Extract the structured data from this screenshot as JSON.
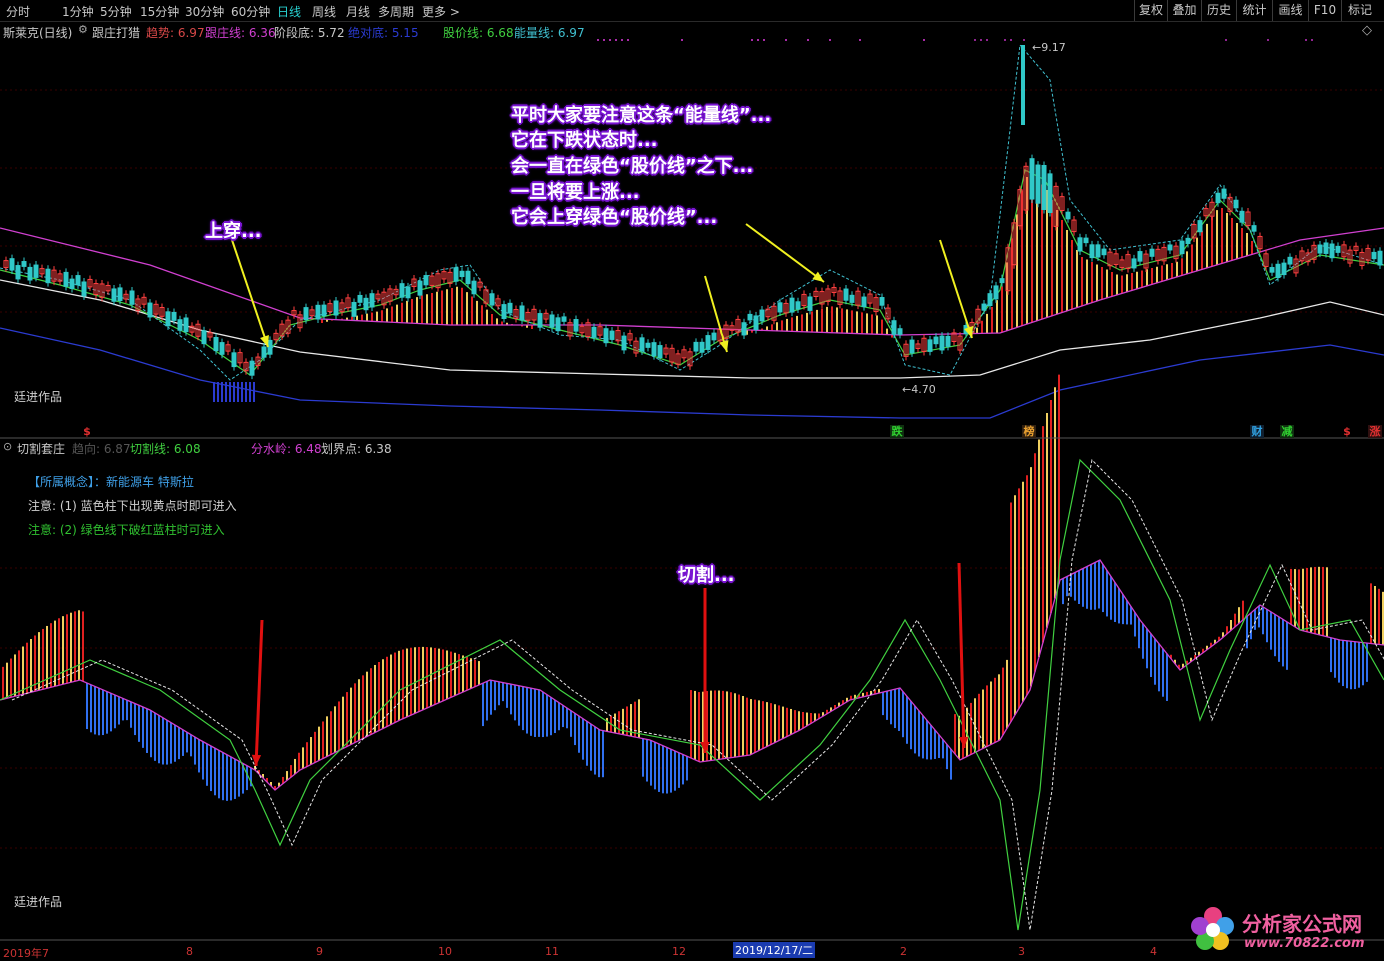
{
  "toolbar": {
    "periods": [
      "分时",
      "1分钟",
      "5分钟",
      "15分钟",
      "30分钟",
      "60分钟",
      "日线",
      "周线",
      "月线",
      "多周期",
      "更多 >"
    ],
    "active_period": "日线",
    "right_buttons": [
      "复权",
      "叠加",
      "历史",
      "统计",
      "画线",
      "F10",
      "标记"
    ]
  },
  "upper_panel": {
    "stock": "斯莱克(日线)",
    "indicator": "跟庄打猎",
    "legend": [
      {
        "label": "趋势: 6.97",
        "color": "#d84848"
      },
      {
        "label": "跟庄线: 6.36",
        "color": "#d040d0"
      },
      {
        "label": "阶段底: 5.72",
        "color": "#c8c8c8"
      },
      {
        "label": "绝对底: 5.15",
        "color": "#2b3bd0"
      },
      {
        "label": "股价线: 6.68",
        "color": "#40d040"
      },
      {
        "label": "能量线: 6.97",
        "color": "#40c0d0"
      }
    ],
    "watermark": "廷进作品",
    "high_label": "9.17",
    "low_label": "4.70",
    "signals": [
      {
        "text": "$",
        "color": "#e03030"
      },
      {
        "text": "跌",
        "color": "#30d030",
        "bg": "#103010"
      },
      {
        "text": "榜",
        "color": "#e8a030",
        "bg": "#302010"
      },
      {
        "text": "财",
        "color": "#30a0e0",
        "bg": "#102030"
      },
      {
        "text": "减",
        "color": "#30d030",
        "bg": "#103010"
      },
      {
        "text": "$",
        "color": "#e03030"
      },
      {
        "text": "涨",
        "color": "#e03030",
        "bg": "#301010"
      }
    ]
  },
  "annotations": {
    "up_cross": "上穿...",
    "energy_note": [
      "平时大家要注意这条“能量线”...",
      "它在下跌状态时...",
      "会一直在绿色“股价线”之下...",
      "一旦将要上涨...",
      "它会上穿绿色“股价线”..."
    ],
    "cut": "切割..."
  },
  "lower_panel": {
    "indicator": "切割套庄",
    "legend": [
      {
        "label": "趋向: 6.87",
        "color": "#555555"
      },
      {
        "label": "切割线: 6.08",
        "color": "#40d040"
      },
      {
        "label": "分水岭: 6.48",
        "color": "#d040d0"
      },
      {
        "label": "划界点: 6.38",
        "color": "#c8c8c8"
      }
    ],
    "concept_tag": "【所属概念】：新能源车 特斯拉",
    "note1": "注意: (1) 蓝色柱下出现黄点时即可进入",
    "note2": "注意: (2) 绿色线下破红蓝柱时可进入",
    "watermark": "廷进作品"
  },
  "date_axis": {
    "labels": [
      "2019年7",
      "8",
      "9",
      "10",
      "11",
      "12",
      "2019/12/17/二",
      "2",
      "3",
      "4"
    ]
  },
  "logo": {
    "name": "分析家公式网",
    "url": "www.70822.com"
  },
  "colors": {
    "bg": "#000000",
    "grid": "#3a0000",
    "yellow_arrow": "#f0f020",
    "red_arrow": "#e01010"
  }
}
